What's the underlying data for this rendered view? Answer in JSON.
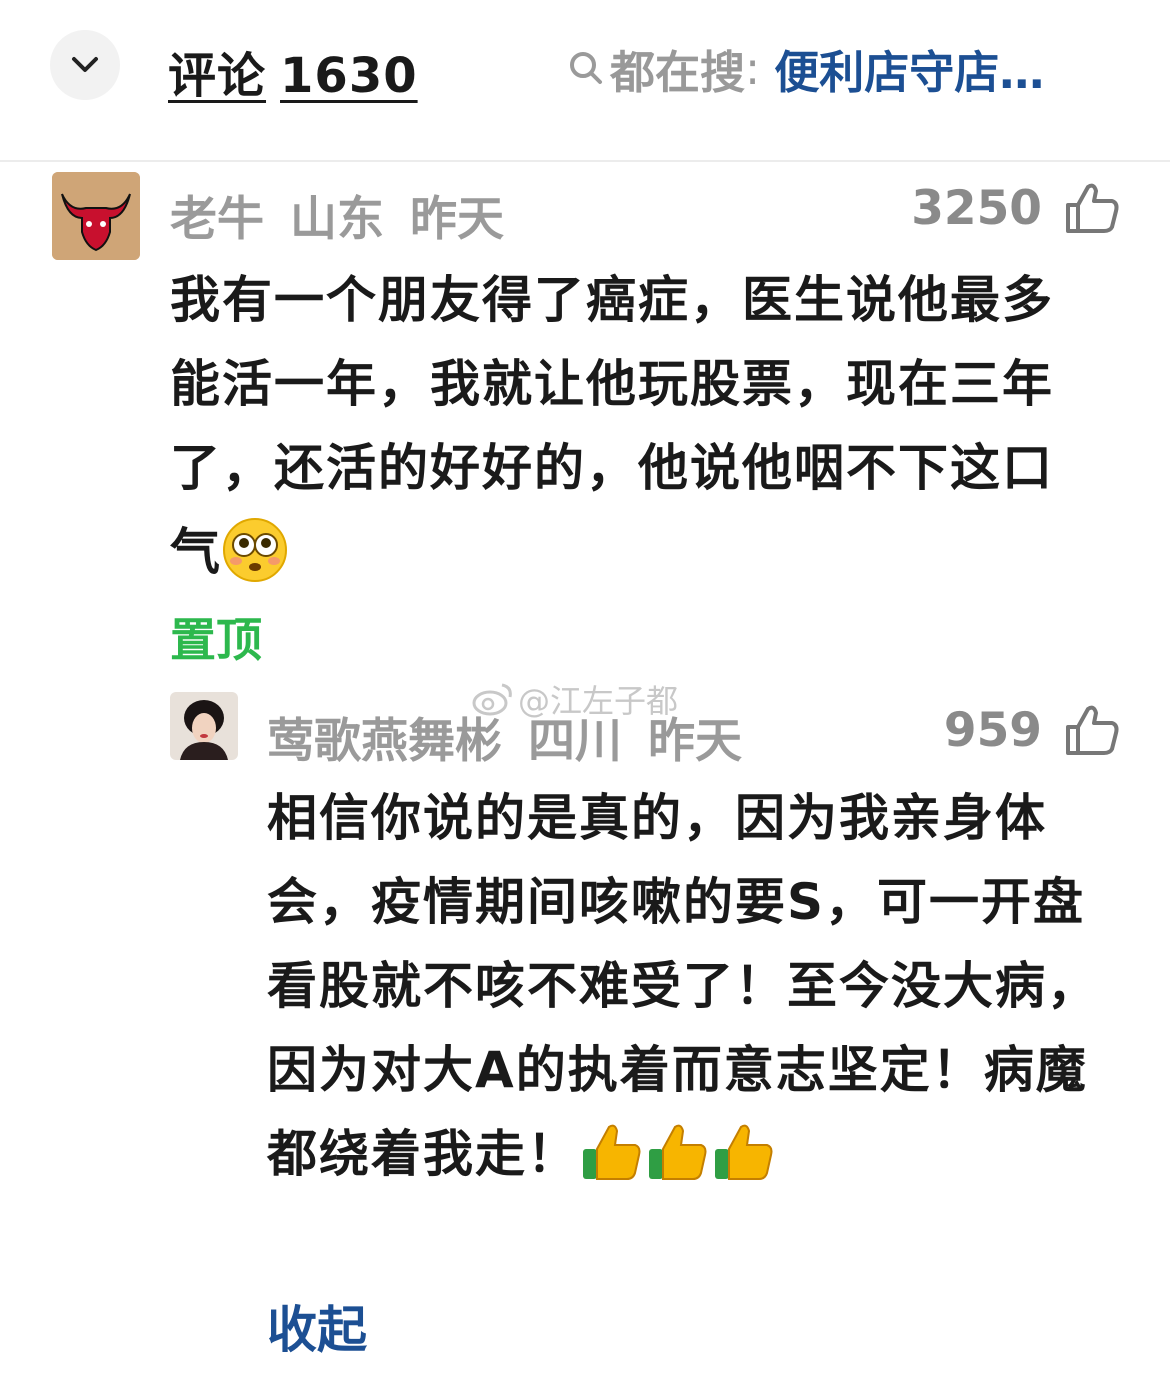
{
  "header": {
    "title_prefix": "评论",
    "comment_count": "1630",
    "trending_label": "都在搜",
    "trending_colon": ":",
    "trending_query": "便利店守店…"
  },
  "comments": [
    {
      "username": "老牛",
      "location": "山东",
      "time": "昨天",
      "likes": "3250",
      "text": "我有一个朋友得了癌症，医生说他最多能活一年，我就让他玩股票，现在三年了，还活的好好的，他说他咽不下这口气",
      "pinned_label": "置顶"
    },
    {
      "username": "莺歌燕舞彬",
      "location": "四川",
      "time": "昨天",
      "likes": "959",
      "text": "相信你说的是真的，因为我亲身体会，疫情期间咳嗽的要S，可一开盘看股就不咳不难受了！至今没大病，因为对大A的执着而意志坚定！病魔都绕着我走！",
      "collapse_label": "收起"
    }
  ],
  "watermark": "@江左子都",
  "colors": {
    "accent_blue": "#1c4f93",
    "pin_green": "#2db84d",
    "meta_gray": "#9a9a9a"
  },
  "icons": [
    "chevron-down-icon",
    "search-icon",
    "thumbs-up-icon",
    "flushed-face-emoji",
    "thumbs-up-emoji",
    "weibo-logo-icon"
  ]
}
